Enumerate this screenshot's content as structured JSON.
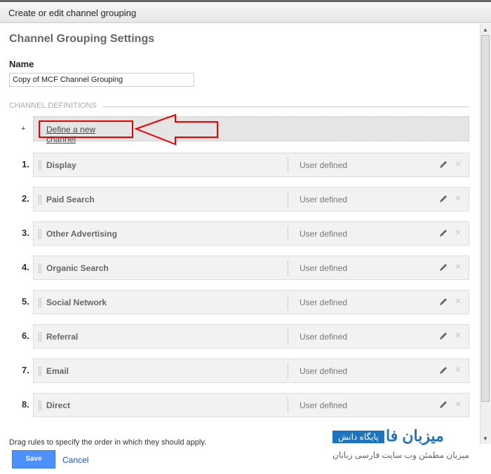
{
  "window": {
    "title": "Create or edit channel grouping"
  },
  "settings": {
    "heading": "Channel Grouping Settings",
    "name_label": "Name",
    "name_value": "Copy of MCF Channel Grouping",
    "definitions_label": "CHANNEL DEFINITIONS",
    "add_symbol": "+",
    "define_new": "Define a new channel"
  },
  "channels": [
    {
      "num": "1.",
      "name": "Display",
      "type": "User defined"
    },
    {
      "num": "2.",
      "name": "Paid Search",
      "type": "User defined"
    },
    {
      "num": "3.",
      "name": "Other Advertising",
      "type": "User defined"
    },
    {
      "num": "4.",
      "name": "Organic Search",
      "type": "User defined"
    },
    {
      "num": "5.",
      "name": "Social Network",
      "type": "User defined"
    },
    {
      "num": "6.",
      "name": "Referral",
      "type": "User defined"
    },
    {
      "num": "7.",
      "name": "Email",
      "type": "User defined"
    },
    {
      "num": "8.",
      "name": "Direct",
      "type": "User defined"
    }
  ],
  "hint": "Drag rules to specify the order in which they should apply.",
  "footer": {
    "save": "Save",
    "cancel": "Cancel"
  },
  "watermark": {
    "badge": "پایگاه دانش",
    "logo": "میزبان فا",
    "tagline": "میزبان مطمئن وب سایت فارسی زبانان"
  },
  "colors": {
    "accent": "#4d90fe",
    "annotation": "#e00000"
  }
}
